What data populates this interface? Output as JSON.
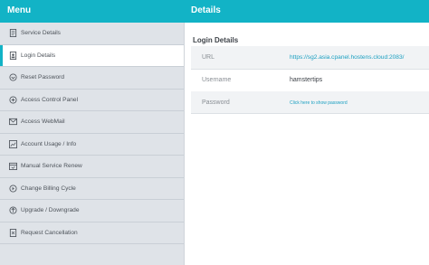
{
  "header": {
    "menu_title": "Menu",
    "details_title": "Details"
  },
  "sidebar": {
    "items": [
      {
        "label": "Service Details",
        "icon": "document-icon",
        "active": false
      },
      {
        "label": "Login Details",
        "icon": "login-icon",
        "active": true
      },
      {
        "label": "Reset Password",
        "icon": "key-icon",
        "active": false
      },
      {
        "label": "Access Control Panel",
        "icon": "control-panel-icon",
        "active": false
      },
      {
        "label": "Access WebMail",
        "icon": "mail-icon",
        "active": false
      },
      {
        "label": "Account Usage / Info",
        "icon": "chart-icon",
        "active": false
      },
      {
        "label": "Manual Service Renew",
        "icon": "calendar-icon",
        "active": false
      },
      {
        "label": "Change Billing Cycle",
        "icon": "cycle-icon",
        "active": false
      },
      {
        "label": "Upgrade / Downgrade",
        "icon": "upgrade-icon",
        "active": false
      },
      {
        "label": "Request Cancellation",
        "icon": "cancel-icon",
        "active": false
      }
    ]
  },
  "details": {
    "section_title": "Login Details",
    "rows": [
      {
        "key": "URL",
        "value": "https://sg2.asia.cpanel.hostens.cloud:2083/"
      },
      {
        "key": "Username",
        "value": "hamstertips"
      },
      {
        "key": "Password",
        "value": "Click here to show password"
      }
    ]
  },
  "colors": {
    "accent": "#12b3c6",
    "sidebar_bg": "#dfe3e8",
    "link": "#1a9fc1"
  }
}
